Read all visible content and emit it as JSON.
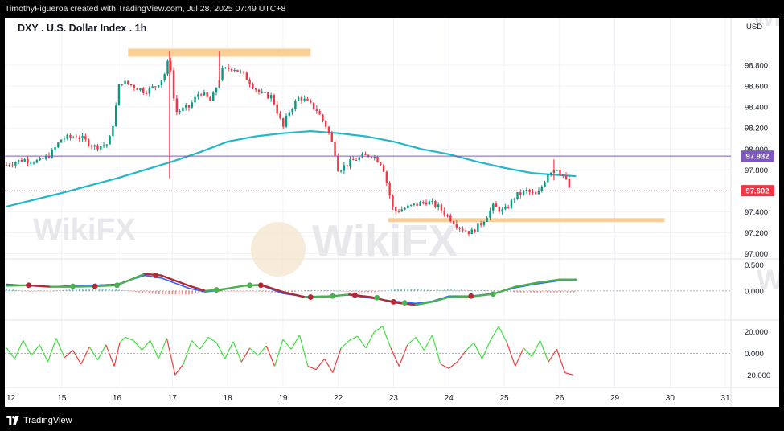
{
  "header": {
    "attribution": "TimothyFigueroa created with TradingView.com, Jul 28, 2025 07:49 UTC+8"
  },
  "symbol": {
    "title": "DXY . U.S. Dollar Index . 1h",
    "currency": "USD"
  },
  "footer": {
    "brand": "TradingView"
  },
  "watermark": {
    "text": "WikiFX"
  },
  "colors": {
    "up": "#089981",
    "down": "#f23645",
    "ma_line": "#22b8c8",
    "resistance_line": "#7e57c2",
    "zone": "#f9c98a",
    "last_price_badge": "#f23645",
    "level_badge": "#7e57c2",
    "macd_line": "#2962ff",
    "signal_line": "#b22833",
    "signal_up": "#4caf50",
    "osc_up": "#3ee03e",
    "osc_down": "#f03c3c"
  },
  "chart_data": [
    {
      "type": "candlestick",
      "panel": "price",
      "ylim": [
        96.95,
        99.1
      ],
      "y_ticks": [
        "98.800",
        "98.600",
        "98.400",
        "98.200",
        "98.000",
        "97.800",
        "97.400",
        "97.200",
        "97.000"
      ],
      "x_tick_labels": [
        "12",
        "15",
        "16",
        "17",
        "18",
        "19",
        "22",
        "23",
        "24",
        "25",
        "26",
        "29",
        "30",
        "31"
      ],
      "x_tick_positions": [
        0,
        1,
        2,
        3,
        4,
        5,
        6,
        7,
        8,
        9,
        10,
        11,
        12,
        13
      ],
      "x_range": [
        0,
        13.1
      ],
      "close_path": [
        [
          0.0,
          97.85
        ],
        [
          0.3,
          97.9
        ],
        [
          0.6,
          97.88
        ],
        [
          0.8,
          97.95
        ],
        [
          1.0,
          98.1
        ],
        [
          1.3,
          98.12
        ],
        [
          1.6,
          98.02
        ],
        [
          1.85,
          98.05
        ],
        [
          1.95,
          98.3
        ],
        [
          2.05,
          98.65
        ],
        [
          2.3,
          98.6
        ],
        [
          2.5,
          98.55
        ],
        [
          2.7,
          98.6
        ],
        [
          2.85,
          98.7
        ],
        [
          2.95,
          98.88
        ],
        [
          3.05,
          98.35
        ],
        [
          3.3,
          98.4
        ],
        [
          3.5,
          98.55
        ],
        [
          3.7,
          98.45
        ],
        [
          3.9,
          98.75
        ],
        [
          4.1,
          98.78
        ],
        [
          4.3,
          98.7
        ],
        [
          4.6,
          98.52
        ],
        [
          4.8,
          98.5
        ],
        [
          5.0,
          98.2
        ],
        [
          5.1,
          98.35
        ],
        [
          5.3,
          98.5
        ],
        [
          5.6,
          98.38
        ],
        [
          5.8,
          98.2
        ],
        [
          5.95,
          97.95
        ],
        [
          6.0,
          97.8
        ],
        [
          6.3,
          97.9
        ],
        [
          6.6,
          97.95
        ],
        [
          6.8,
          97.85
        ],
        [
          7.0,
          97.4
        ],
        [
          7.3,
          97.45
        ],
        [
          7.6,
          97.5
        ],
        [
          7.8,
          97.45
        ],
        [
          8.0,
          97.35
        ],
        [
          8.2,
          97.25
        ],
        [
          8.4,
          97.2
        ],
        [
          8.6,
          97.3
        ],
        [
          8.8,
          97.45
        ],
        [
          9.0,
          97.4
        ],
        [
          9.2,
          97.55
        ],
        [
          9.4,
          97.6
        ],
        [
          9.6,
          97.55
        ],
        [
          9.8,
          97.78
        ],
        [
          9.95,
          97.82
        ],
        [
          10.1,
          97.72
        ],
        [
          10.2,
          97.6
        ]
      ],
      "spikes": [
        {
          "x": 2.95,
          "high": 98.93,
          "low": 97.72
        },
        {
          "x": 3.85,
          "high": 98.93,
          "low": 98.6
        },
        {
          "x": 9.9,
          "high": 97.9,
          "low": 97.7
        }
      ],
      "moving_average": [
        [
          0,
          97.45
        ],
        [
          1,
          97.58
        ],
        [
          2,
          97.72
        ],
        [
          3,
          97.88
        ],
        [
          3.5,
          97.97
        ],
        [
          4,
          98.07
        ],
        [
          4.5,
          98.12
        ],
        [
          5,
          98.15
        ],
        [
          5.5,
          98.17
        ],
        [
          6,
          98.15
        ],
        [
          6.5,
          98.12
        ],
        [
          7,
          98.07
        ],
        [
          7.5,
          98.0
        ],
        [
          8,
          97.95
        ],
        [
          8.5,
          97.88
        ],
        [
          9,
          97.82
        ],
        [
          9.5,
          97.77
        ],
        [
          10,
          97.75
        ],
        [
          10.3,
          97.74
        ]
      ],
      "zones": [
        {
          "x0": 2.2,
          "x1": 5.5,
          "y": 98.92,
          "label": ""
        },
        {
          "x0": 6.9,
          "x1": 11.9,
          "y": 97.32,
          "label": ""
        }
      ],
      "horizontal_level": {
        "value": 97.932,
        "label": "97.932"
      },
      "last_price": {
        "value": 97.602,
        "label": "97.602"
      }
    },
    {
      "type": "line",
      "panel": "macd",
      "y_ticks": [
        "0.500",
        "0.000"
      ],
      "ylim": [
        -0.5,
        0.62
      ],
      "series": [
        {
          "role": "macd",
          "values": [
            [
              0,
              0.13
            ],
            [
              0.4,
              0.1
            ],
            [
              0.8,
              0.08
            ],
            [
              1.2,
              0.1
            ],
            [
              1.6,
              0.11
            ],
            [
              2.0,
              0.13
            ],
            [
              2.5,
              0.3
            ],
            [
              2.8,
              0.25
            ],
            [
              3.3,
              0.05
            ],
            [
              3.6,
              -0.02
            ],
            [
              3.9,
              0.02
            ],
            [
              4.3,
              0.1
            ],
            [
              4.6,
              0.11
            ],
            [
              5.0,
              -0.05
            ],
            [
              5.4,
              -0.11
            ],
            [
              5.8,
              -0.1
            ],
            [
              6.2,
              -0.08
            ],
            [
              6.6,
              -0.14
            ],
            [
              7.0,
              -0.2
            ],
            [
              7.4,
              -0.24
            ],
            [
              7.7,
              -0.2
            ],
            [
              8.0,
              -0.1
            ],
            [
              8.4,
              -0.1
            ],
            [
              8.8,
              -0.05
            ],
            [
              9.2,
              0.06
            ],
            [
              9.6,
              0.14
            ],
            [
              10.0,
              0.2
            ],
            [
              10.3,
              0.2
            ]
          ]
        },
        {
          "role": "signal",
          "values": [
            [
              0,
              0.1
            ],
            [
              0.4,
              0.11
            ],
            [
              0.8,
              0.08
            ],
            [
              1.2,
              0.08
            ],
            [
              1.6,
              0.09
            ],
            [
              2.0,
              0.11
            ],
            [
              2.5,
              0.33
            ],
            [
              2.8,
              0.3
            ],
            [
              3.3,
              0.1
            ],
            [
              3.6,
              0.0
            ],
            [
              3.9,
              0.03
            ],
            [
              4.3,
              0.1
            ],
            [
              4.6,
              0.12
            ],
            [
              5.0,
              -0.02
            ],
            [
              5.4,
              -0.12
            ],
            [
              5.8,
              -0.11
            ],
            [
              6.2,
              -0.07
            ],
            [
              6.6,
              -0.12
            ],
            [
              7.0,
              -0.22
            ],
            [
              7.4,
              -0.27
            ],
            [
              7.7,
              -0.21
            ],
            [
              8.0,
              -0.12
            ],
            [
              8.4,
              -0.11
            ],
            [
              8.8,
              -0.06
            ],
            [
              9.2,
              0.08
            ],
            [
              9.6,
              0.16
            ],
            [
              10.0,
              0.22
            ],
            [
              10.3,
              0.22
            ]
          ]
        }
      ],
      "cross_markers": [
        [
          0.4,
          0.11,
          "down"
        ],
        [
          1.2,
          0.09,
          "up"
        ],
        [
          1.6,
          0.09,
          "down"
        ],
        [
          2.0,
          0.11,
          "up"
        ],
        [
          2.7,
          0.3,
          "down"
        ],
        [
          3.8,
          0.02,
          "up"
        ],
        [
          4.4,
          0.11,
          "up"
        ],
        [
          4.6,
          0.11,
          "down"
        ],
        [
          5.5,
          -0.12,
          "down"
        ],
        [
          5.9,
          -0.1,
          "up"
        ],
        [
          6.3,
          -0.08,
          "down"
        ],
        [
          6.7,
          -0.13,
          "up"
        ],
        [
          7.0,
          -0.21,
          "down"
        ],
        [
          7.2,
          -0.23,
          "up"
        ],
        [
          8.4,
          -0.1,
          "down"
        ],
        [
          8.8,
          -0.06,
          "up"
        ]
      ]
    },
    {
      "type": "line",
      "panel": "oscillator",
      "y_ticks": [
        "20.000",
        "0.000",
        "-20.000"
      ],
      "ylim": [
        -28,
        28
      ],
      "values": [
        [
          0,
          5
        ],
        [
          0.15,
          -5
        ],
        [
          0.3,
          12
        ],
        [
          0.45,
          -2
        ],
        [
          0.6,
          8
        ],
        [
          0.75,
          -8
        ],
        [
          0.9,
          14
        ],
        [
          1.05,
          -4
        ],
        [
          1.2,
          3
        ],
        [
          1.35,
          -10
        ],
        [
          1.5,
          6
        ],
        [
          1.65,
          -6
        ],
        [
          1.8,
          8
        ],
        [
          1.95,
          -12
        ],
        [
          2.05,
          10
        ],
        [
          2.15,
          15
        ],
        [
          2.3,
          12
        ],
        [
          2.45,
          3
        ],
        [
          2.6,
          12
        ],
        [
          2.75,
          -5
        ],
        [
          2.9,
          14
        ],
        [
          3.05,
          -20
        ],
        [
          3.2,
          -10
        ],
        [
          3.35,
          12
        ],
        [
          3.5,
          4
        ],
        [
          3.65,
          15
        ],
        [
          3.8,
          10
        ],
        [
          3.95,
          -5
        ],
        [
          4.1,
          11
        ],
        [
          4.25,
          -8
        ],
        [
          4.4,
          5
        ],
        [
          4.55,
          -2
        ],
        [
          4.7,
          7
        ],
        [
          4.85,
          -12
        ],
        [
          5.0,
          13
        ],
        [
          5.15,
          4
        ],
        [
          5.3,
          17
        ],
        [
          5.45,
          -12
        ],
        [
          5.6,
          -15
        ],
        [
          5.75,
          -5
        ],
        [
          5.9,
          -18
        ],
        [
          6.05,
          5
        ],
        [
          6.2,
          12
        ],
        [
          6.35,
          16
        ],
        [
          6.5,
          5
        ],
        [
          6.65,
          20
        ],
        [
          6.8,
          25
        ],
        [
          6.95,
          5
        ],
        [
          7.1,
          -12
        ],
        [
          7.25,
          8
        ],
        [
          7.4,
          15
        ],
        [
          7.55,
          3
        ],
        [
          7.7,
          17
        ],
        [
          7.85,
          -10
        ],
        [
          8.0,
          -14
        ],
        [
          8.15,
          -8
        ],
        [
          8.3,
          2
        ],
        [
          8.45,
          10
        ],
        [
          8.6,
          -5
        ],
        [
          8.75,
          12
        ],
        [
          8.9,
          25
        ],
        [
          9.05,
          10
        ],
        [
          9.2,
          -12
        ],
        [
          9.35,
          5
        ],
        [
          9.5,
          -3
        ],
        [
          9.65,
          12
        ],
        [
          9.8,
          -8
        ],
        [
          9.95,
          4
        ],
        [
          10.1,
          -18
        ],
        [
          10.25,
          -20
        ]
      ]
    }
  ]
}
